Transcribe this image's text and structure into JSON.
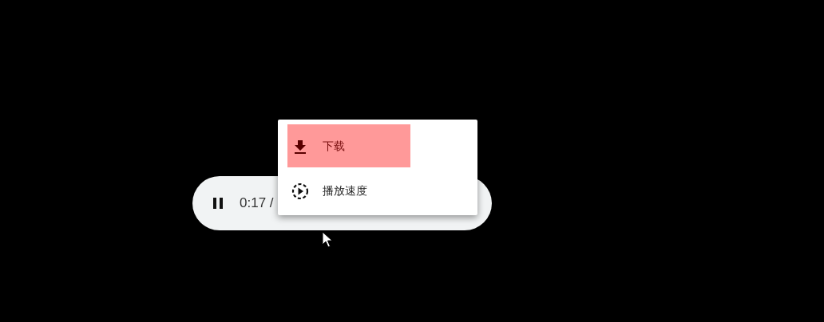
{
  "player": {
    "playing": true,
    "time": "0:17 /"
  },
  "menu": {
    "items": [
      {
        "label": "下载",
        "kind": "download",
        "selected": true
      },
      {
        "label": "播放速度",
        "kind": "speed",
        "selected": false
      }
    ]
  }
}
